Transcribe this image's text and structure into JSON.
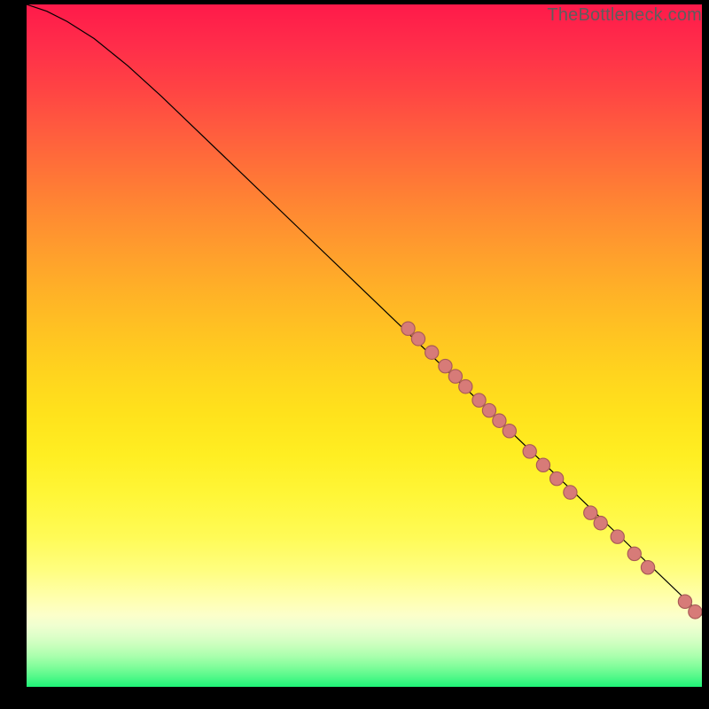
{
  "attribution": "TheBottleneck.com",
  "colors": {
    "curve": "#000000",
    "dot_fill": "#d77b78",
    "dot_stroke": "#a85a56"
  },
  "chart_data": {
    "type": "line",
    "title": "",
    "xlabel": "",
    "ylabel": "",
    "xlim": [
      0,
      100
    ],
    "ylim": [
      0,
      100
    ],
    "grid": false,
    "series": [
      {
        "name": "curve",
        "x": [
          0,
          3,
          6,
          10,
          15,
          20,
          30,
          40,
          50,
          60,
          70,
          80,
          90,
          100
        ],
        "y": [
          100,
          99,
          97.5,
          95,
          91,
          86.5,
          77,
          67.5,
          58,
          48.5,
          39,
          29.5,
          20,
          10.5
        ]
      }
    ],
    "points": [
      {
        "x": 56.5,
        "y": 52.5
      },
      {
        "x": 58.0,
        "y": 51.0
      },
      {
        "x": 60.0,
        "y": 49.0
      },
      {
        "x": 62.0,
        "y": 47.0
      },
      {
        "x": 63.5,
        "y": 45.5
      },
      {
        "x": 65.0,
        "y": 44.0
      },
      {
        "x": 67.0,
        "y": 42.0
      },
      {
        "x": 68.5,
        "y": 40.5
      },
      {
        "x": 70.0,
        "y": 39.0
      },
      {
        "x": 71.5,
        "y": 37.5
      },
      {
        "x": 74.5,
        "y": 34.5
      },
      {
        "x": 76.5,
        "y": 32.5
      },
      {
        "x": 78.5,
        "y": 30.5
      },
      {
        "x": 80.5,
        "y": 28.5
      },
      {
        "x": 83.5,
        "y": 25.5
      },
      {
        "x": 85.0,
        "y": 24.0
      },
      {
        "x": 87.5,
        "y": 22.0
      },
      {
        "x": 90.0,
        "y": 19.5
      },
      {
        "x": 92.0,
        "y": 17.5
      },
      {
        "x": 97.5,
        "y": 12.5
      },
      {
        "x": 99.0,
        "y": 11.0
      }
    ]
  }
}
